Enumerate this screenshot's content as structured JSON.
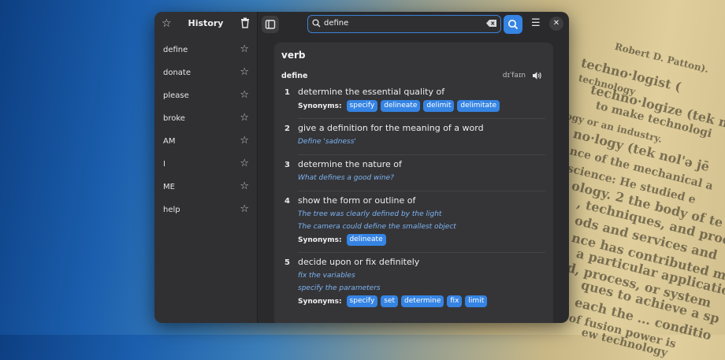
{
  "background_text": [
    "Robert D. Patton).",
    "techno·logist (",
    "technology",
    "techno·logize (tek no",
    "to make technologi",
    "ogy or an industry.",
    "no·logy (tek nol'ə jē",
    "nce of the mechanical a",
    "science: He studied e",
    "ology. 2 the body of te",
    ", techniques, and proc",
    "ods and services and",
    "nce has contributed m",
    "a particular applicatio",
    "d, process, or system",
    "ques to achieve a sp",
    "each the ... conditio",
    "of fusion power is",
    "ew technology"
  ],
  "sidebar": {
    "title": "History",
    "items": [
      {
        "label": "define"
      },
      {
        "label": "donate"
      },
      {
        "label": "please"
      },
      {
        "label": "broke"
      },
      {
        "label": "AM"
      },
      {
        "label": "I"
      },
      {
        "label": "ME"
      },
      {
        "label": "help"
      }
    ]
  },
  "search": {
    "value": "define"
  },
  "entry": {
    "pos": "verb",
    "headword": "define",
    "pronunciation": "dɪˈfaɪn",
    "synonyms_label": "Synonyms:",
    "senses": [
      {
        "num": "1",
        "definition": "determine the essential quality of",
        "examples": [],
        "synonyms": [
          "specify",
          "delineate",
          "delimit",
          "delimitate"
        ]
      },
      {
        "num": "2",
        "definition": "give a definition for the meaning of a word",
        "examples": [
          "Define 'sadness'"
        ],
        "synonyms": []
      },
      {
        "num": "3",
        "definition": "determine the nature of",
        "examples": [
          "What defines a good wine?"
        ],
        "synonyms": []
      },
      {
        "num": "4",
        "definition": "show the form or outline of",
        "examples": [
          "The tree was clearly defined by the light",
          "The camera could define the smallest object"
        ],
        "synonyms": [
          "delineate"
        ]
      },
      {
        "num": "5",
        "definition": "decide upon or fix definitely",
        "examples": [
          "fix the variables",
          "specify the parameters"
        ],
        "synonyms": [
          "specify",
          "set",
          "determine",
          "fix",
          "limit"
        ]
      }
    ]
  },
  "colors": {
    "accent": "#3584e4",
    "example": "#7db3f0",
    "window": "#2a2a2d",
    "card": "#353538"
  }
}
